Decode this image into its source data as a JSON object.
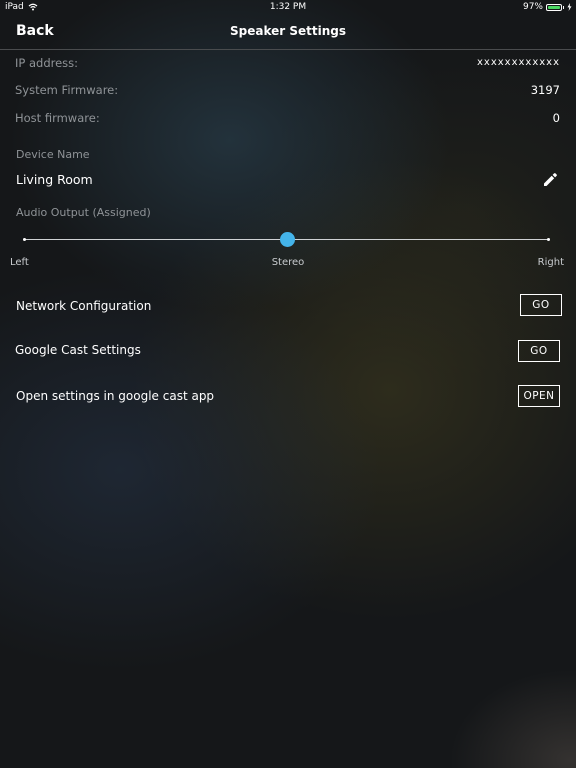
{
  "status_bar": {
    "device": "iPad",
    "time": "1:32 PM",
    "battery": "97%",
    "battery_level": 0.97
  },
  "nav": {
    "back_label": "Back",
    "title": "Speaker Settings"
  },
  "info": {
    "ip_label": "IP address:",
    "ip_value": "xxxxxxxxxxxx",
    "system_fw_label": "System Firmware:",
    "system_fw_value": "3197",
    "host_fw_label": "Host firmware:",
    "host_fw_value": "0"
  },
  "device": {
    "name_label": "Device Name",
    "name_value": "Living Room"
  },
  "audio_output": {
    "label": "Audio Output (Assigned)",
    "left_label": "Left",
    "center_label": "Stereo",
    "right_label": "Right",
    "slider_value": 0.5,
    "accent_color": "#44b4ea"
  },
  "actions": {
    "network_label": "Network Configuration",
    "network_button": "GO",
    "cast_label": "Google Cast Settings",
    "cast_button": "GO",
    "open_label": "Open settings in google cast app",
    "open_button": "OPEN"
  }
}
